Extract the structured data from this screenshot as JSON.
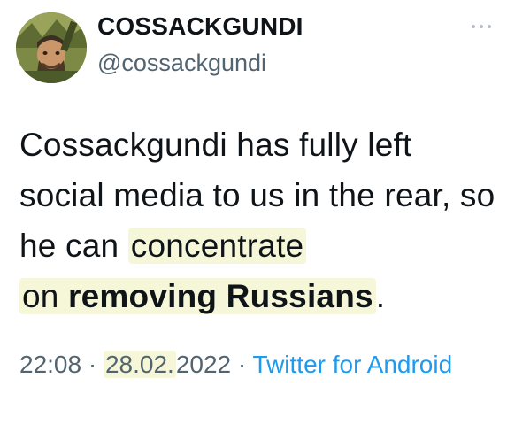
{
  "author": {
    "display_name": "COSSACKGUNDI",
    "handle": "@cossackgundi"
  },
  "tweet": {
    "text_1": "Cossackgundi has fully left social media to us in the rear, so he can ",
    "text_hl_1": "concentrate",
    "text_hl_2a": "on ",
    "text_hl_2b": "removing Russians",
    "text_end": "."
  },
  "meta": {
    "time": "22:08",
    "sep1": " · ",
    "date_hl": "28.02.",
    "date_rest": "2022",
    "sep2": " · ",
    "source": "Twitter for Android"
  },
  "icons": {
    "more": "more-dots-icon",
    "avatar": "avatar"
  },
  "colors": {
    "text": "#0f1419",
    "secondary": "#536471",
    "link": "#1d9bf0",
    "highlight": "#f6f7d8"
  }
}
